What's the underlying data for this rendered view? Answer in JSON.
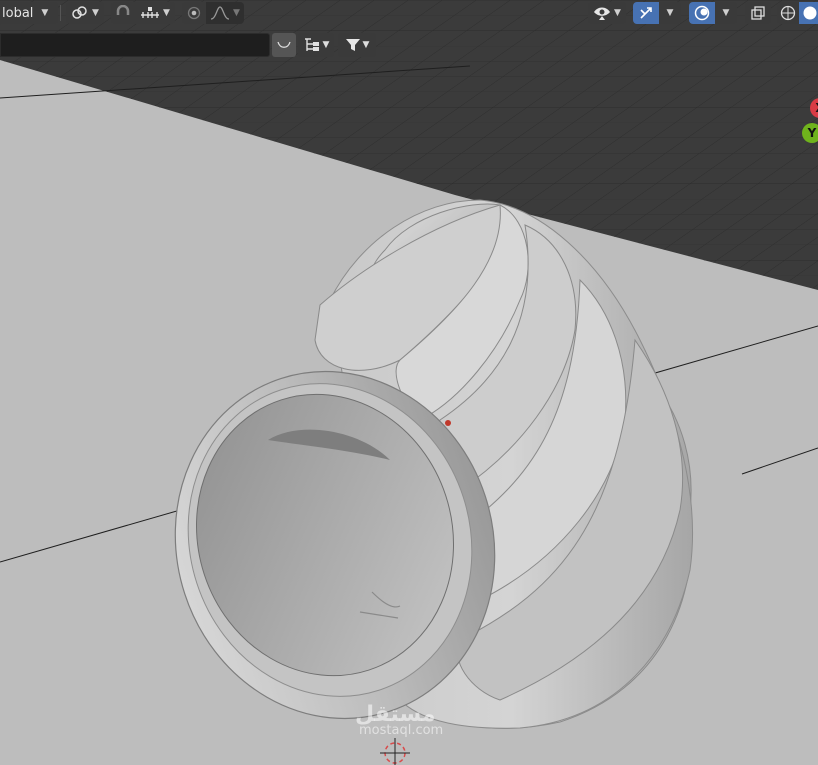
{
  "header": {
    "transform_orientation": "lobal",
    "icons": {
      "pivot": "pivot-icon",
      "snap": "magnet-icon",
      "snap_increment": "snap-increment-icon",
      "proportional": "proportional-edit-icon",
      "falloff": "falloff-curve-icon",
      "visibility": "eye-icon",
      "gizmo": "gizmo-icon",
      "overlay": "overlay-icon",
      "xray": "xray-icon",
      "shading_wire": "wireframe-shading-icon",
      "shading_solid": "solid-shading-icon"
    }
  },
  "subheader": {
    "search_value": "",
    "icons": {
      "curve": "curve-icon",
      "hierarchy": "hierarchy-icon",
      "filter": "filter-icon"
    }
  },
  "navigation_gizmo": {
    "x_label": "X",
    "y_label": "Y",
    "x_color": "#d93b45",
    "y_color": "#6fb31c"
  },
  "watermark": {
    "main": "مستقل",
    "sub": "mostaql.com"
  },
  "colors": {
    "active_button": "#4772b3",
    "button": "#3a3a3a",
    "grid_dark": "#3a3a3a",
    "floor": "#bdbdbd",
    "model": "#b9b9b9"
  }
}
